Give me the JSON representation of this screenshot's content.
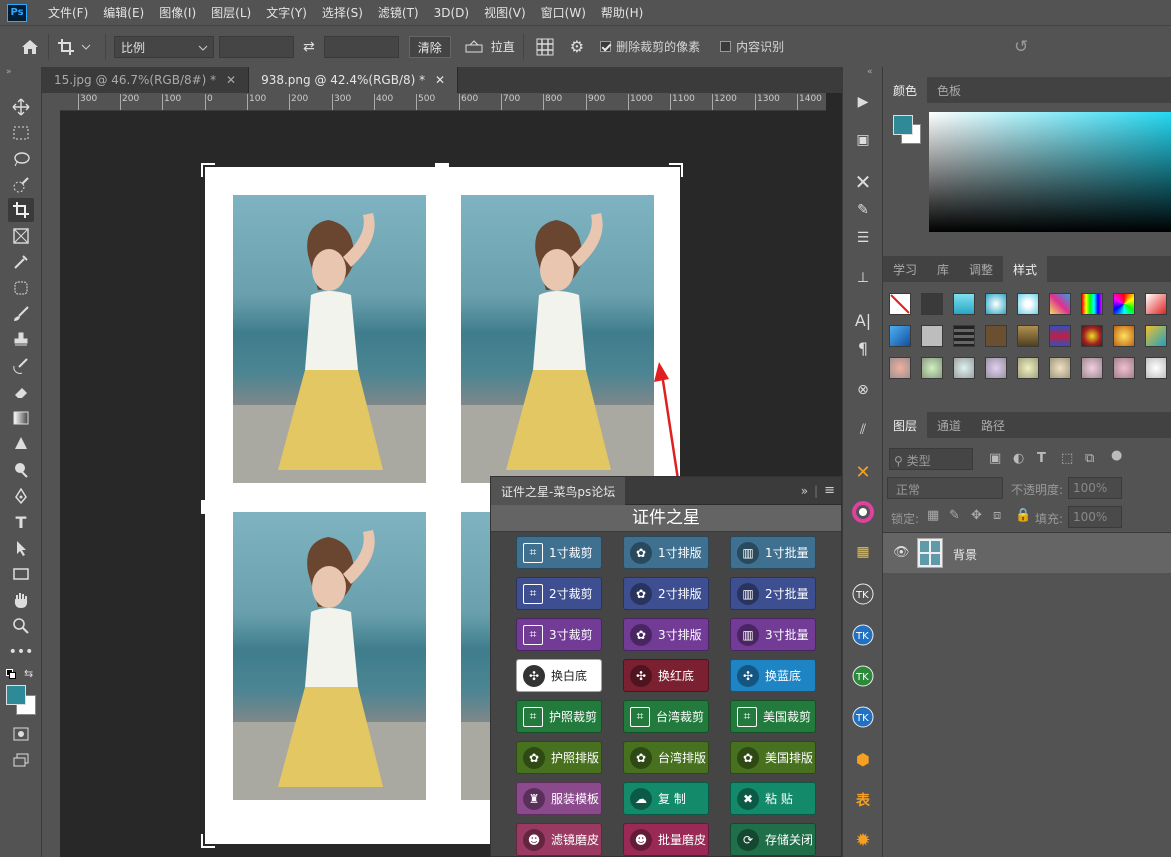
{
  "menubar": {
    "logo": "Ps",
    "items": [
      "文件(F)",
      "编辑(E)",
      "图像(I)",
      "图层(L)",
      "文字(Y)",
      "选择(S)",
      "滤镜(T)",
      "3D(D)",
      "视图(V)",
      "窗口(W)",
      "帮助(H)"
    ]
  },
  "options": {
    "ratio_select": "比例",
    "clear_button": "清除",
    "straighten_label": "拉直",
    "delete_pixels_label": "删除裁剪的像素",
    "delete_pixels_checked": true,
    "content_aware_label": "内容识别",
    "content_aware_checked": false
  },
  "doc_tabs": [
    {
      "label": "15.jpg @ 46.7%(RGB/8#) *",
      "active": false
    },
    {
      "label": "938.png @ 42.4%(RGB/8) *",
      "active": true
    }
  ],
  "ruler_labels": [
    "300",
    "200",
    "100",
    "0",
    "100",
    "200",
    "300",
    "400",
    "500",
    "600",
    "700",
    "800",
    "900",
    "1000",
    "1100",
    "1200",
    "1300",
    "1400"
  ],
  "color_panel": {
    "tabs": [
      "颜色",
      "色板"
    ],
    "foreground": "#2e8a97",
    "background": "#ffffff",
    "picker_hue": "#23d8f2"
  },
  "styles_panel": {
    "tabs": [
      "学习",
      "库",
      "调整",
      "样式"
    ]
  },
  "layers_panel": {
    "tabs": [
      "图层",
      "通道",
      "路径"
    ],
    "filter_label": "类型",
    "blend_mode": "正常",
    "opacity_label": "不透明度:",
    "opacity_value": "100%",
    "lock_label": "锁定:",
    "fill_label": "填充:",
    "fill_value": "100%",
    "layer_name": "背景"
  },
  "plugin": {
    "tab_label": "证件之星-菜鸟ps论坛",
    "title": "证件之星",
    "buttons": [
      {
        "label": "1寸裁剪",
        "color": "#3f7090",
        "icon": "crop"
      },
      {
        "label": "1寸排版",
        "color": "#3f7090",
        "icon": "gear"
      },
      {
        "label": "1寸批量",
        "color": "#3f7090",
        "icon": "chart"
      },
      {
        "label": "2寸裁剪",
        "color": "#3e4f91",
        "icon": "crop"
      },
      {
        "label": "2寸排版",
        "color": "#3e4f91",
        "icon": "gear"
      },
      {
        "label": "2寸批量",
        "color": "#3e4f91",
        "icon": "chart"
      },
      {
        "label": "3寸裁剪",
        "color": "#713b96",
        "icon": "crop"
      },
      {
        "label": "3寸排版",
        "color": "#713b96",
        "icon": "gear"
      },
      {
        "label": "3寸批量",
        "color": "#713b96",
        "icon": "chart"
      },
      {
        "label": "换白底",
        "color": "#ffffff",
        "icon": "swap",
        "dark_text": true
      },
      {
        "label": "换红底",
        "color": "#7a2030",
        "icon": "swap"
      },
      {
        "label": "换蓝底",
        "color": "#1f84c4",
        "icon": "swap"
      },
      {
        "label": "护照裁剪",
        "color": "#227a3d",
        "icon": "crop"
      },
      {
        "label": "台湾裁剪",
        "color": "#227a3d",
        "icon": "crop"
      },
      {
        "label": "美国裁剪",
        "color": "#227a3d",
        "icon": "crop"
      },
      {
        "label": "护照排版",
        "color": "#47701f",
        "icon": "gear"
      },
      {
        "label": "台湾排版",
        "color": "#47701f",
        "icon": "gear"
      },
      {
        "label": "美国排版",
        "color": "#47701f",
        "icon": "gear"
      },
      {
        "label": "服装模板",
        "color": "#8a4a8c",
        "icon": "shirt"
      },
      {
        "label": "复 制",
        "color": "#138a6a",
        "icon": "copy"
      },
      {
        "label": "粘 贴",
        "color": "#138a6a",
        "icon": "paste"
      },
      {
        "label": "滤镜磨皮",
        "color": "#9a3a62",
        "icon": "person"
      },
      {
        "label": "批量磨皮",
        "color": "#9a2a55",
        "icon": "person"
      },
      {
        "label": "存储关闭",
        "color": "#1f6f4a",
        "icon": "save"
      }
    ]
  }
}
